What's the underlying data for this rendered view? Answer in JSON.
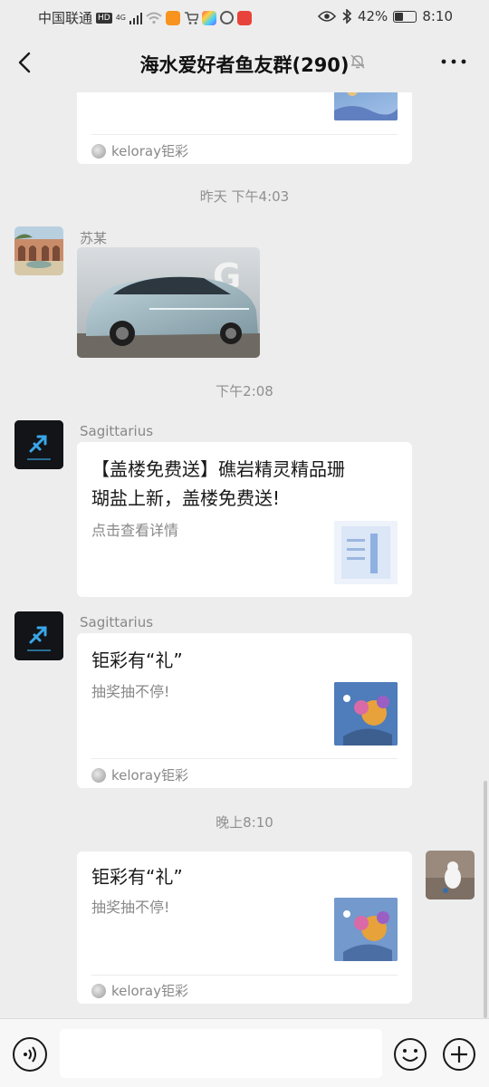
{
  "status_bar": {
    "carrier": "中国联通",
    "net_badge": "HD",
    "signal": "4G",
    "battery": "42%",
    "battery_level": 0.42,
    "time": "8:10"
  },
  "header": {
    "title": "海水爱好者鱼友群(290)"
  },
  "messages": {
    "m0": {
      "source": "keloray钜彩"
    },
    "t1": "昨天 下午4:03",
    "m1": {
      "sender": "苏某"
    },
    "t2": "下午2:08",
    "m2": {
      "sender": "Sagittarius",
      "title_line1": "【盖楼免费送】礁岩精灵精品珊",
      "title_line2": "瑚盐上新，盖楼免费送!",
      "desc": "点击查看详情"
    },
    "m3": {
      "sender": "Sagittarius",
      "title": "钜彩有“礼”",
      "desc": "抽奖抽不停!",
      "source": "keloray钜彩"
    },
    "t3": "晚上8:10",
    "m4": {
      "title": "钜彩有“礼”",
      "desc": "抽奖抽不停!",
      "source": "keloray钜彩"
    }
  },
  "colors": {
    "background": "#ededed",
    "bubble": "#ffffff",
    "meta_text": "#888888"
  },
  "icons": [
    "back-arrow-icon",
    "mute-bell-icon",
    "more-icon",
    "voice-icon",
    "emoji-icon",
    "plus-icon"
  ]
}
